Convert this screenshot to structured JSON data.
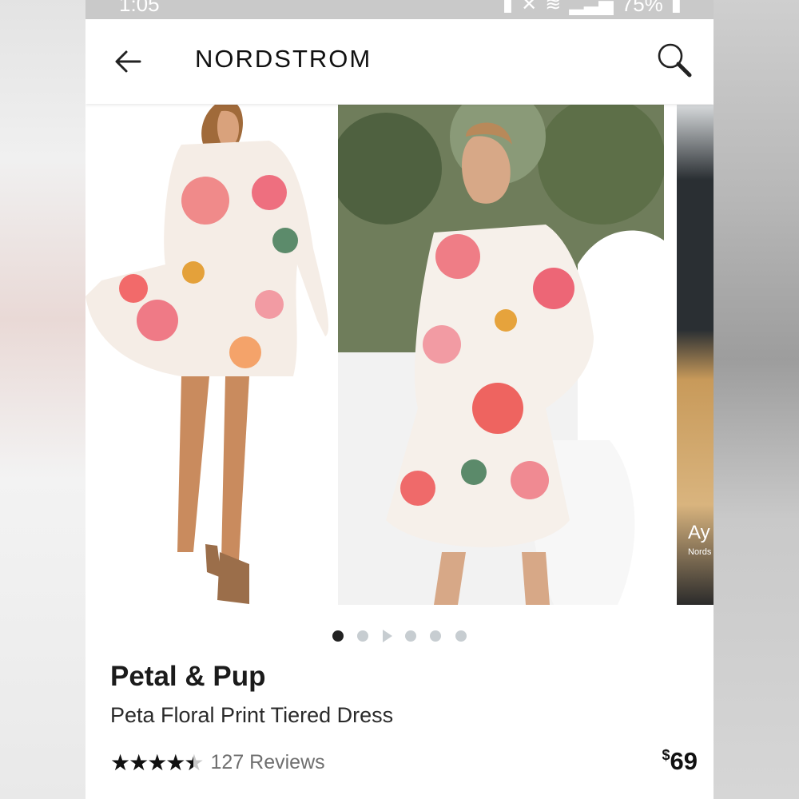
{
  "status_bar": {
    "time": "1:05",
    "battery_percent": "75%"
  },
  "header": {
    "logo_text": "NORDSTROM"
  },
  "carousel": {
    "slide_count": 6,
    "active_index": 0,
    "third_slide_label": "Ay",
    "third_slide_sublabel": "Nords"
  },
  "product": {
    "brand": "Petal & Pup",
    "name": "Peta Floral Print Tiered Dress",
    "rating": 4.5,
    "reviews_text": "127 Reviews",
    "price_currency": "$",
    "price_value": "69"
  },
  "icons": {
    "back": "arrow-left-icon",
    "search": "search-icon",
    "rating": "star-icon"
  },
  "colors": {
    "accent": "#111111",
    "muted": "#6f6f6f",
    "dot_inactive": "#c7cdd1"
  }
}
